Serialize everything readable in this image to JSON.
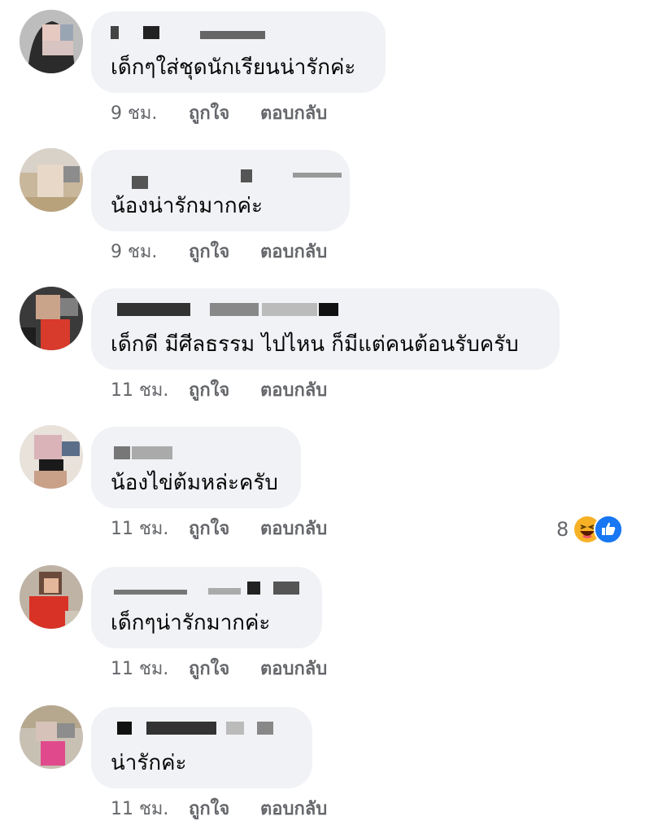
{
  "comments": [
    {
      "text": "เด็กๆใส่ชุดนักเรียนน่ารักค่ะ",
      "time": "9 ชม.",
      "like_label": "ถูกใจ",
      "reply_label": "ตอบกลับ",
      "reaction_count": null
    },
    {
      "text": "น้องน่ารักมากค่ะ",
      "time": "9 ชม.",
      "like_label": "ถูกใจ",
      "reply_label": "ตอบกลับ",
      "reaction_count": null
    },
    {
      "text": "เด็กดี มีศีลธรรม ไปไหน ก็มีแต่คนต้อนรับครับ",
      "time": "11 ชม.",
      "like_label": "ถูกใจ",
      "reply_label": "ตอบกลับ",
      "reaction_count": null
    },
    {
      "text": "น้องไข่ต้มหล่ะครับ",
      "time": "11 ชม.",
      "like_label": "ถูกใจ",
      "reply_label": "ตอบกลับ",
      "reaction_count": "8"
    },
    {
      "text": "เด็กๆน่ารักมากค่ะ",
      "time": "11 ชม.",
      "like_label": "ถูกใจ",
      "reply_label": "ตอบกลับ",
      "reaction_count": null
    },
    {
      "text": "น่ารักค่ะ",
      "time": "11 ชม.",
      "like_label": "ถูกใจ",
      "reply_label": "ตอบกลับ",
      "reaction_count": null
    }
  ],
  "icons": {
    "reaction_haha": "haha-icon",
    "reaction_like": "like-icon"
  },
  "colors": {
    "bubble": "#f0f2f5",
    "meta_text": "#65676b",
    "like_blue": "#1877f2",
    "haha_yellow": "#f7b125"
  }
}
